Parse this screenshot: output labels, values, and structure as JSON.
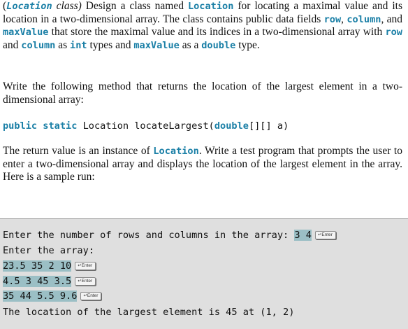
{
  "exercise": {
    "p1": {
      "paren_open": "(",
      "class_name": "Location",
      "class_word": " class)",
      "intro": " Design a class named ",
      "class_name2": "Location",
      "text1": " for locating a maximal value and its location in a two-dimensional array. The class contains public data fields ",
      "field_row": "row",
      "sep1": ", ",
      "field_column": "column",
      "text2": ", and ",
      "field_max": "maxValue",
      "text3": " that store the maximal value and its indices in a two-dimensional array with ",
      "field_row2": "row",
      "text4": " and ",
      "field_column2": "column",
      "text5": " as ",
      "type_int": "int",
      "text6": " types and ",
      "field_max2": "maxValue",
      "text7": " as a ",
      "type_double": "double",
      "text8": " type."
    },
    "p2": "Write the following method that returns the location of the largest element in a two-dimensional array:",
    "signature": {
      "kw1": "public",
      "sp1": " ",
      "kw2": "static",
      "rest1": " Location locateLargest(",
      "kw3": "double",
      "rest2": "[][] a)"
    },
    "p3": {
      "text1": "The return value is an instance of ",
      "class_name": "Location",
      "text2": ". Write a test program that prompts the user to enter a two-dimensional array and displays the location of the largest element in the array. Here is a sample run:"
    }
  },
  "sample_run": {
    "prompt_rows_cols": "Enter the number of rows and columns in the array: ",
    "input_rows_cols": "3 4",
    "enter_key_label": "↵Enter",
    "prompt_array": "Enter the array:",
    "rows": [
      "23.5 35 2 10",
      "4.5 3 45 3.5",
      "35 44 5.5 9.6"
    ],
    "output": "The location of the largest element is 45 at (1, 2)"
  },
  "colors": {
    "code_accent": "#1a7fa6",
    "input_highlight": "#9bbfc5",
    "run_background": "#dfdfdf"
  }
}
